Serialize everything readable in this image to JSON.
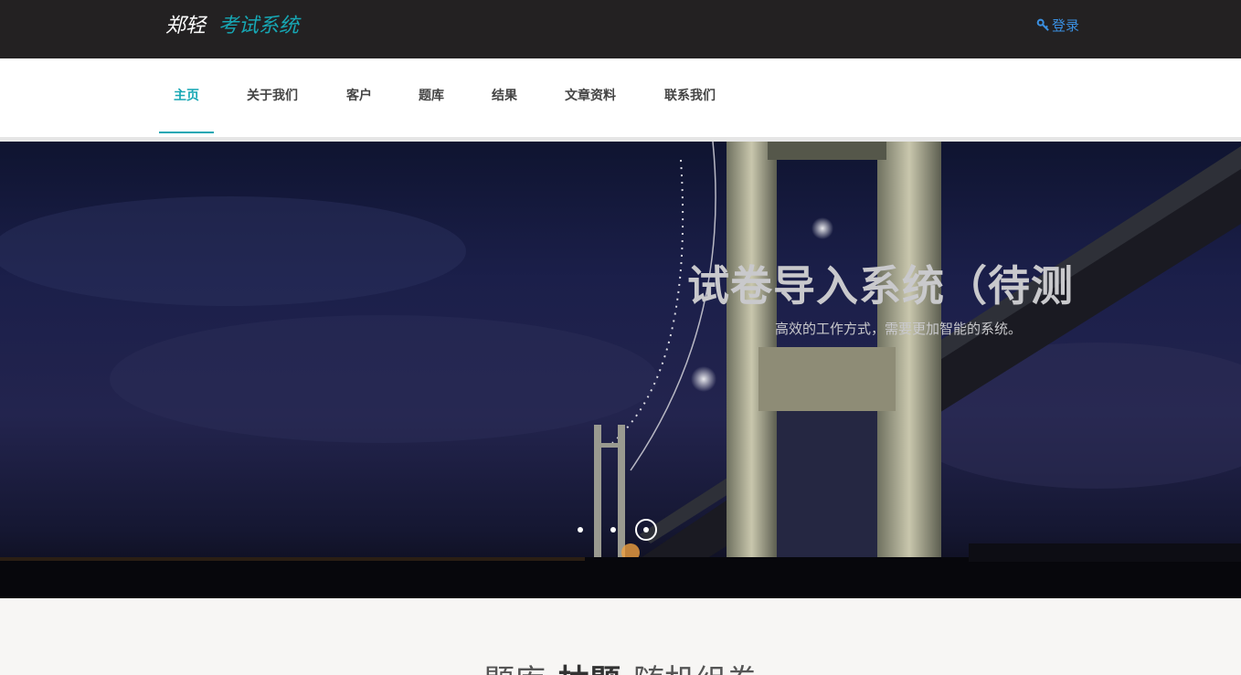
{
  "header": {
    "brand_name": "郑轻",
    "brand_system": "考试系统",
    "login_label": "登录",
    "login_icon": "key-icon",
    "accent_color": "#17a7b4",
    "link_color": "#3a8fe0"
  },
  "nav": {
    "items": [
      {
        "label": "主页",
        "active": true
      },
      {
        "label": "关于我们",
        "active": false
      },
      {
        "label": "客户",
        "active": false
      },
      {
        "label": "题库",
        "active": false
      },
      {
        "label": "结果",
        "active": false
      },
      {
        "label": "文章资料",
        "active": false
      },
      {
        "label": "联系我们",
        "active": false
      }
    ]
  },
  "hero": {
    "title": "试卷导入系统（待测",
    "subtitle": "高效的工作方式，需要更加智能的系统。",
    "slide_count": 3,
    "active_slide": 3
  },
  "section": {
    "heading_left": "题库",
    "heading_bold": "抽题",
    "heading_right": "随机组卷"
  }
}
